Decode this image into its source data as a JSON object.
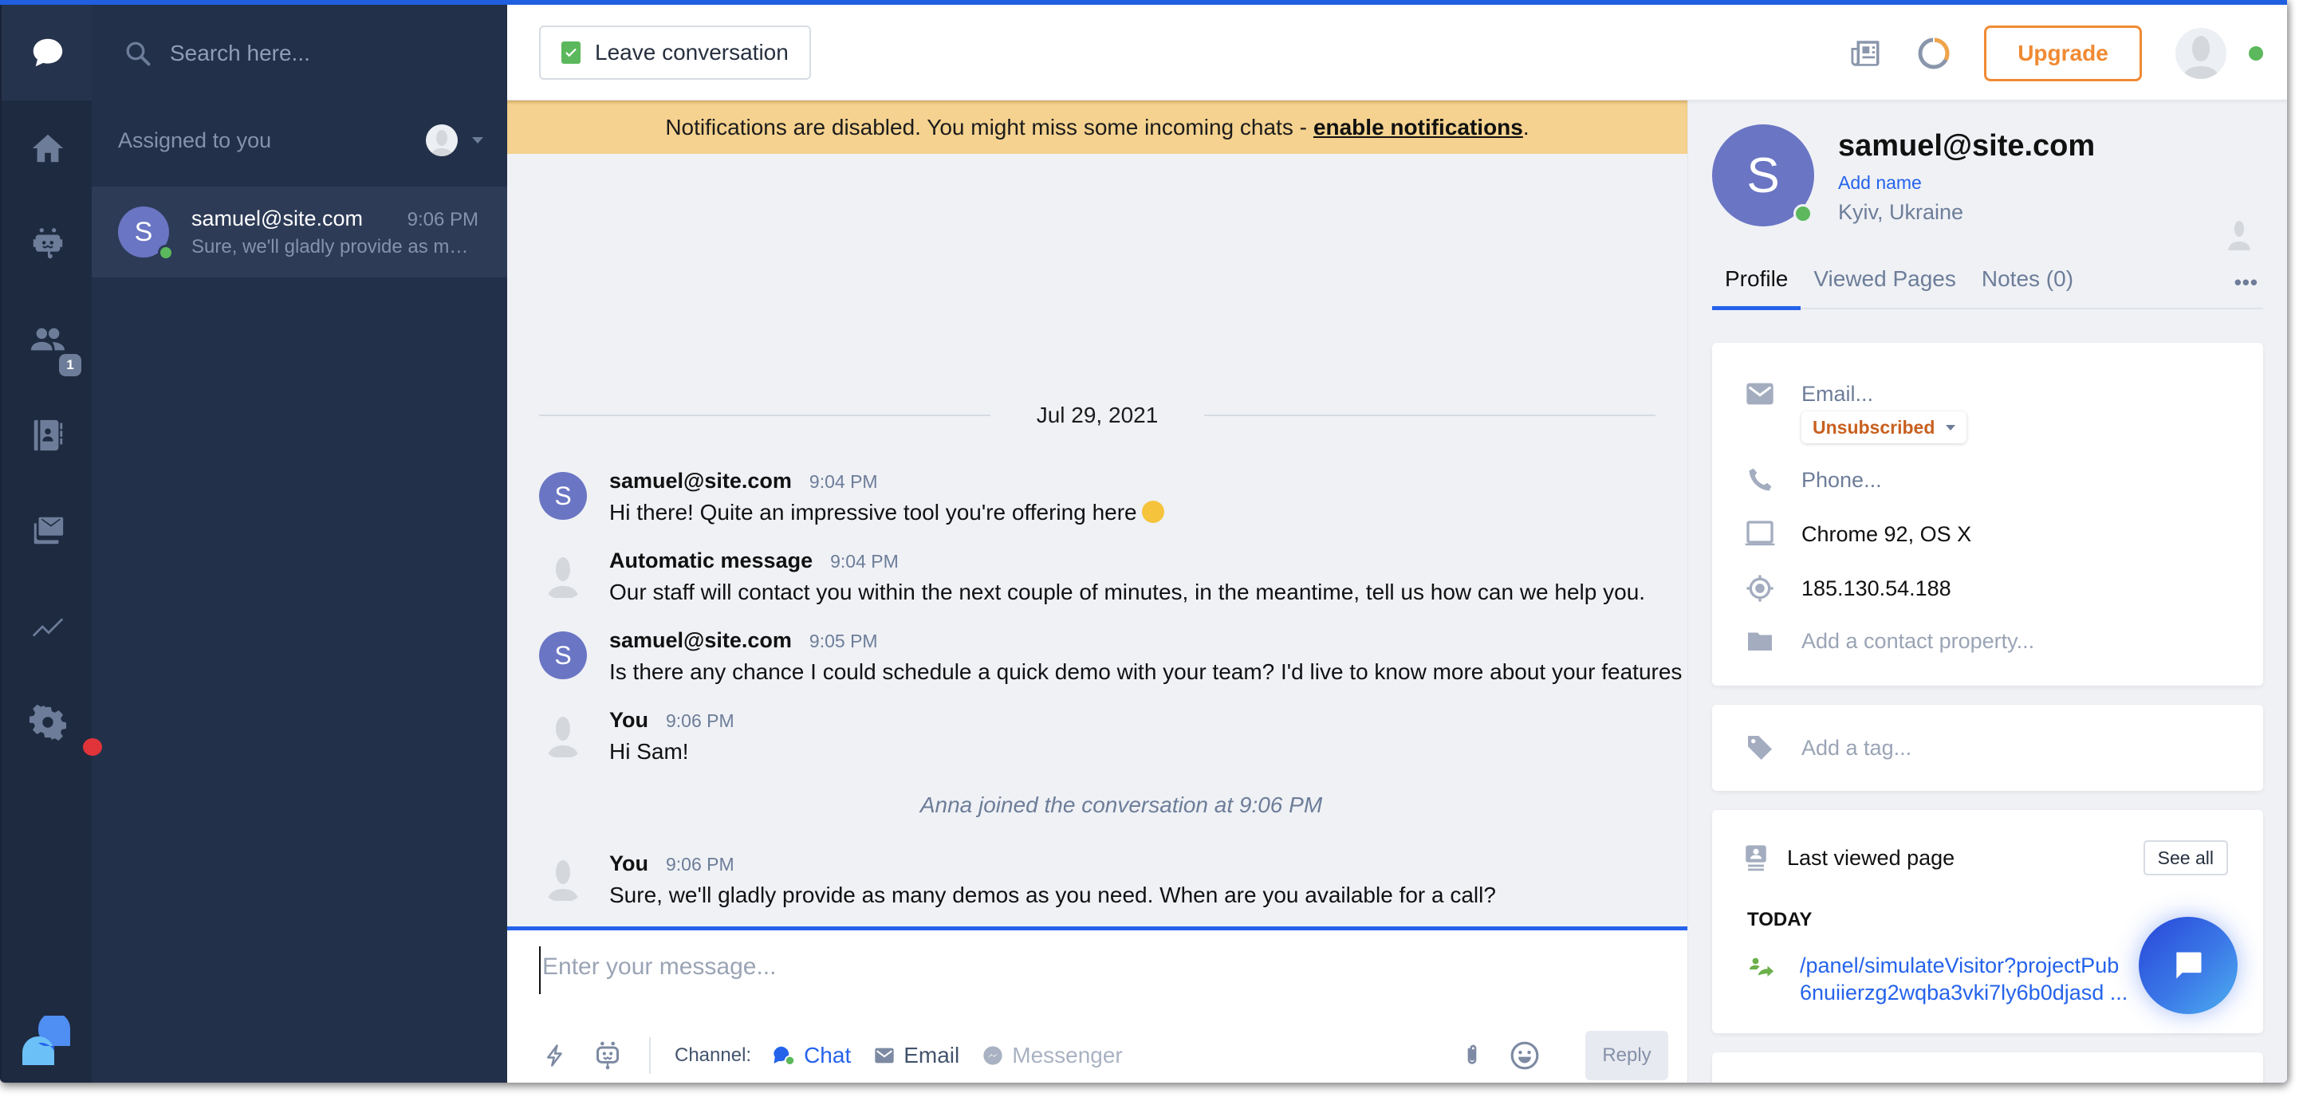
{
  "rail": {
    "items": [
      {
        "name": "chats",
        "icon": "chat-bubble-icon",
        "active": true
      },
      {
        "name": "home",
        "icon": "home-icon"
      },
      {
        "name": "bots",
        "icon": "bot-icon"
      },
      {
        "name": "visitors",
        "icon": "users-icon",
        "badge": "1"
      },
      {
        "name": "contacts",
        "icon": "contacts-book-icon"
      },
      {
        "name": "mailbox",
        "icon": "mail-stack-icon"
      },
      {
        "name": "analytics",
        "icon": "chart-line-icon"
      },
      {
        "name": "settings",
        "icon": "gear-icon"
      }
    ],
    "badge_count": "1",
    "colors": {
      "active": "#ffffff",
      "inactive": "#6d7d99",
      "alert": "#e0343a"
    }
  },
  "conversation_list": {
    "search_placeholder": "Search here...",
    "filter_label": "Assigned to you",
    "conversations": [
      {
        "initial": "S",
        "name": "samuel@site.com",
        "time": "9:06 PM",
        "preview": "Sure, we'll gladly provide as man...",
        "online": true
      }
    ]
  },
  "toolbar": {
    "leave_label": "Leave conversation",
    "upgrade_label": "Upgrade",
    "icons": [
      "news-icon",
      "progress-ring-icon"
    ],
    "agent_status": "online",
    "colors": {
      "upgrade": "#f08a33",
      "online": "#5cb85c",
      "accent": "#2563eb"
    }
  },
  "notification": {
    "text": "Notifications are disabled. You might miss some incoming chats -",
    "link": "enable notifications",
    "suffix": "."
  },
  "chat": {
    "date": "Jul 29, 2021",
    "messages": [
      {
        "type": "visitor",
        "initial": "S",
        "author": "samuel@site.com",
        "time": "9:04 PM",
        "text": "Hi there! Quite an impressive tool you're offering here",
        "emoji": "grinning-face"
      },
      {
        "type": "agent",
        "author": "Automatic message",
        "time": "9:04 PM",
        "text": "Our staff will contact you within the next couple of minutes, in the meantime, tell us how can we help you."
      },
      {
        "type": "visitor",
        "initial": "S",
        "author": "samuel@site.com",
        "time": "9:05 PM",
        "text": "Is there any chance I could schedule a quick demo with your team? I'd live to know more about your features"
      },
      {
        "type": "agent",
        "author": "You",
        "time": "9:06 PM",
        "text": "Hi Sam!"
      },
      {
        "type": "system",
        "text": "Anna joined the conversation at 9:06 PM"
      },
      {
        "type": "agent",
        "author": "You",
        "time": "9:06 PM",
        "text": "Sure, we'll gladly provide as many demos as you need. When are you available for a call?"
      }
    ]
  },
  "composer": {
    "placeholder": "Enter your message...",
    "value": "",
    "channel_label": "Channel:",
    "channels": [
      {
        "label": "Chat",
        "active": true
      },
      {
        "label": "Email",
        "active": false
      },
      {
        "label": "Messenger",
        "active": false,
        "disabled": true
      }
    ],
    "reply_label": "Reply"
  },
  "contact": {
    "initial": "S",
    "email": "samuel@site.com",
    "add_name_label": "Add name",
    "location": "Kyiv, Ukraine",
    "online": true,
    "tabs": [
      {
        "label": "Profile",
        "active": true
      },
      {
        "label": "Viewed Pages",
        "active": false
      },
      {
        "label": "Notes (0)",
        "active": false
      }
    ],
    "more_label": "•••",
    "properties": {
      "email_placeholder": "Email...",
      "subscription_status": "Unsubscribed",
      "phone_placeholder": "Phone...",
      "browser": "Chrome 92, OS X",
      "ip": "185.130.54.188",
      "add_property_placeholder": "Add a contact property..."
    },
    "tag_placeholder": "Add a tag...",
    "last_viewed": {
      "title": "Last viewed page",
      "see_all_label": "See all",
      "group_label": "TODAY",
      "url_line1": "/panel/simulateVisitor?projectPub",
      "url_line2": "6nuiierzg2wqba3vki7ly6b0djasd ..."
    }
  }
}
